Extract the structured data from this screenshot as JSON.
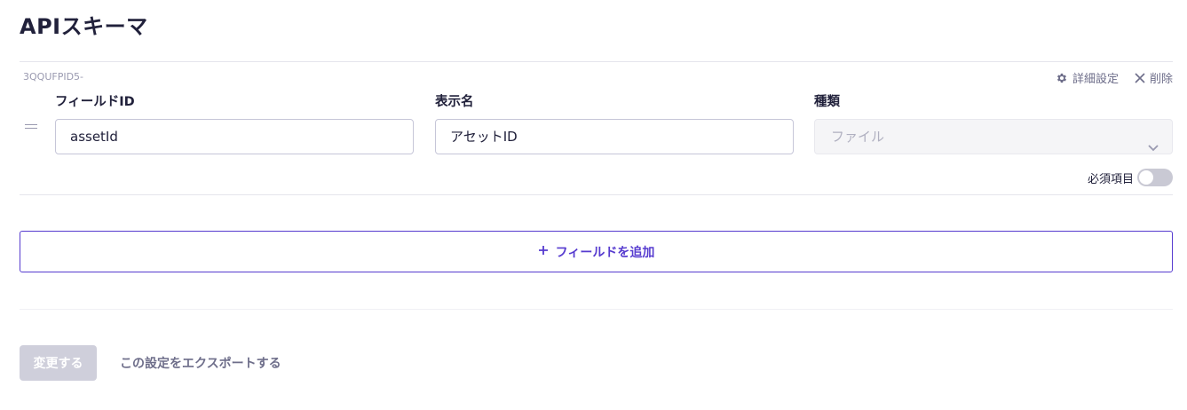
{
  "page": {
    "title": "APIスキーマ"
  },
  "field_row": {
    "field_key": "3QQUFPID5-",
    "actions": {
      "advanced_settings": "詳細設定",
      "delete": "削除"
    },
    "columns": {
      "field_id_label": "フィールドID",
      "display_name_label": "表示名",
      "type_label": "種類"
    },
    "field_id_value": "assetId",
    "display_name_value": "アセットID",
    "type_value": "ファイル",
    "required_label": "必須項目",
    "required_on": false,
    "icons": {
      "advanced": "gear-icon",
      "delete": "close-icon",
      "drag": "drag-handle-icon",
      "select": "chevron-down-icon"
    }
  },
  "add_field": {
    "label": "フィールドを追加",
    "icon": "plus-icon"
  },
  "footer": {
    "submit_label": "変更する",
    "export_label": "この設定をエクスポートする"
  },
  "colors": {
    "accent": "#563bcf",
    "text": "#21213b",
    "muted": "#6e6e8a",
    "disabled_button": "#cfcfdb"
  }
}
